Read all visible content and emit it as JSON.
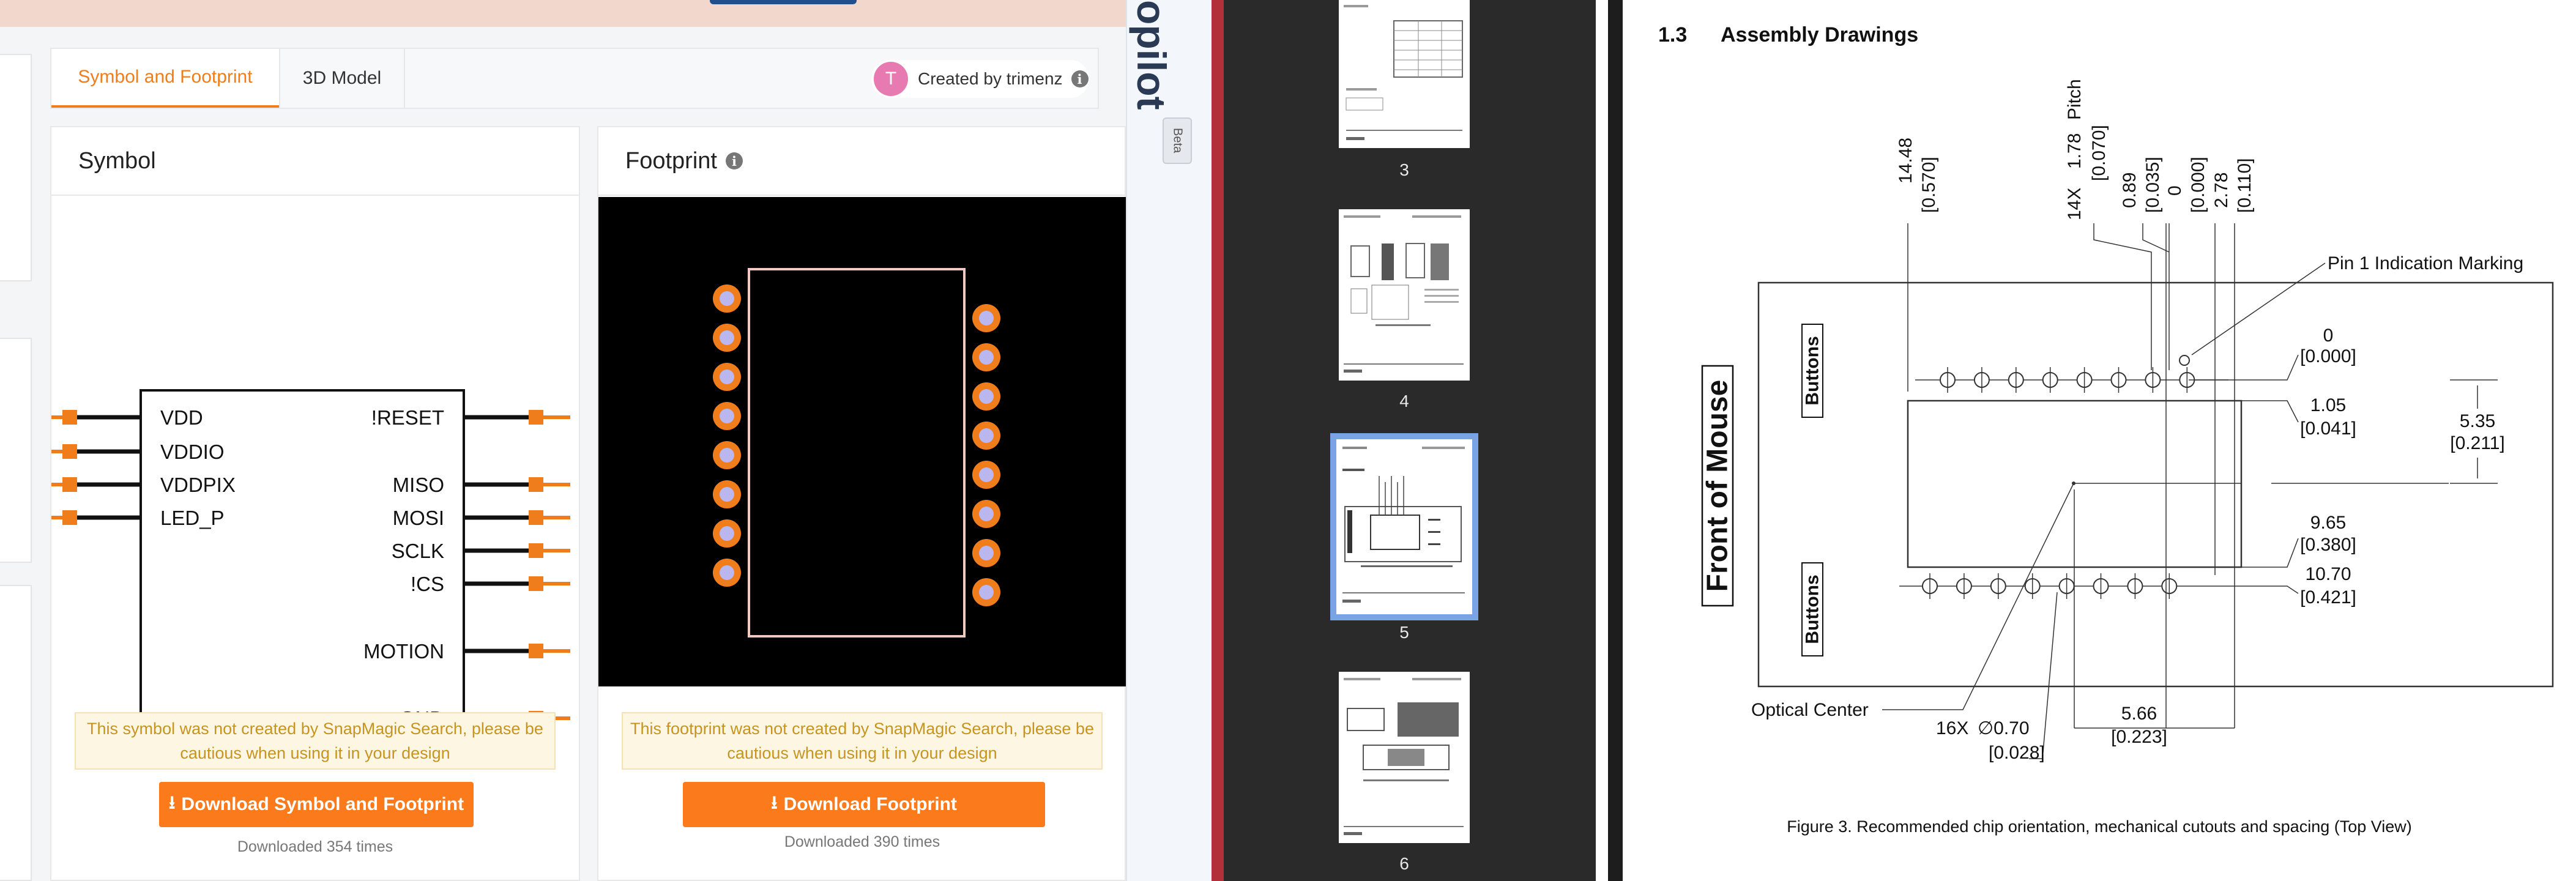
{
  "component_viewer": {
    "tabs": [
      {
        "label": "Symbol and Footprint",
        "active": true
      },
      {
        "label": "3D Model",
        "active": false
      }
    ],
    "creator": {
      "avatar_initial": "T",
      "label": "Created by trimenz",
      "icon": "info-icon"
    },
    "symbol": {
      "title": "Symbol",
      "left_pins": [
        "VDD",
        "VDDIO",
        "VDDPIX",
        "LED_P"
      ],
      "right_pins": [
        "!RESET",
        "MISO",
        "MOSI",
        "SCLK",
        "!CS",
        "MOTION",
        "GND"
      ],
      "warning": "This symbol was not created by SnapMagic Search, please be cautious when using it in your design",
      "download_label": "Download Symbol and Footprint",
      "download_count": "Downloaded 354 times"
    },
    "footprint": {
      "title": "Footprint",
      "warning": "This footprint was not created by SnapMagic Search, please be cautious when using it in your design",
      "download_label": "Download Footprint",
      "download_count": "Downloaded 390 times"
    },
    "colors": {
      "accent": "#fa7a1c",
      "pin": "#f07d1b",
      "pad": "#f07d1b",
      "pad_hole": "#b9b6f0"
    }
  },
  "copilot": {
    "title": "opilot",
    "beta_label": "Beta"
  },
  "thumbnails": {
    "pages": [
      {
        "number": "3",
        "selected": false
      },
      {
        "number": "4",
        "selected": false
      },
      {
        "number": "5",
        "selected": true
      },
      {
        "number": "6",
        "selected": false
      }
    ],
    "selected_color": "#7aa3e5"
  },
  "document": {
    "section_number": "1.3",
    "section_title": "Assembly Drawings",
    "figure_caption": "Figure 3. Recommended chip orientation, mechanical cutouts and spacing (Top View)",
    "drawing": {
      "front_label": "Front of Mouse",
      "buttons_label": "Buttons",
      "pitch_label": "Pitch",
      "pin1_label": "Pin 1 Indication Marking",
      "optical_center_label": "Optical Center",
      "dims": {
        "d1": {
          "mm": "14.48",
          "in": "[0.570]"
        },
        "d2": {
          "prefix": "14X",
          "mm": "1.78",
          "in": "[0.070]"
        },
        "d3": {
          "mm": "0.89",
          "in": "[0.035]"
        },
        "d4": {
          "mm": "0",
          "in": "[0.000]"
        },
        "d5": {
          "mm": "2.78",
          "in": "[0.110]"
        },
        "r1": {
          "mm": "0",
          "in": "[0.000]"
        },
        "r2": {
          "mm": "1.05",
          "in": "[0.041]"
        },
        "r3": {
          "mm": "5.35",
          "in": "[0.211]"
        },
        "r4": {
          "mm": "9.65",
          "in": "[0.380]"
        },
        "r5": {
          "mm": "10.70",
          "in": "[0.421]"
        },
        "b1": {
          "prefix": "16X",
          "mm": "∅0.70",
          "in": "[0.028]"
        },
        "b2": {
          "mm": "5.66",
          "in": "[0.223]"
        }
      }
    }
  }
}
